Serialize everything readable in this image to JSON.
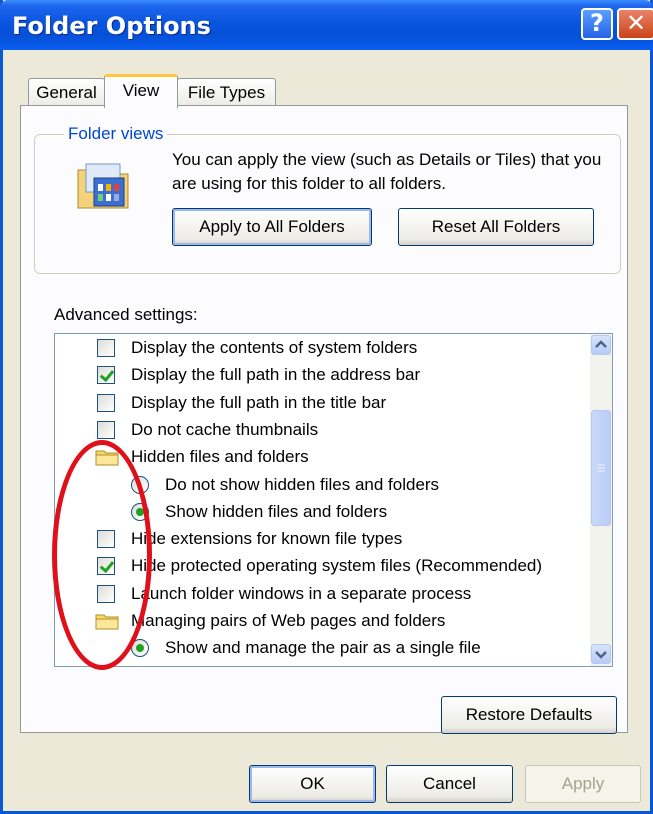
{
  "window": {
    "title": "Folder Options",
    "help_glyph": "?",
    "close_glyph": "✕"
  },
  "tabs": [
    {
      "label": "General",
      "active": false
    },
    {
      "label": "View",
      "active": true
    },
    {
      "label": "File Types",
      "active": false
    }
  ],
  "folder_views": {
    "title": "Folder views",
    "description": "You can apply the view (such as Details or Tiles) that you are using for this folder to all folders.",
    "apply_button": "Apply to All Folders",
    "reset_button": "Reset All Folders",
    "icon": "folder-view-icon"
  },
  "advanced": {
    "label": "Advanced settings:",
    "items": [
      {
        "type": "checkbox",
        "label": "Display the contents of system folders",
        "checked": false,
        "indent": 0
      },
      {
        "type": "checkbox",
        "label": "Display the full path in the address bar",
        "checked": true,
        "indent": 0
      },
      {
        "type": "checkbox",
        "label": "Display the full path in the title bar",
        "checked": false,
        "indent": 0
      },
      {
        "type": "checkbox",
        "label": "Do not cache thumbnails",
        "checked": false,
        "indent": 0
      },
      {
        "type": "folder",
        "label": "Hidden files and folders",
        "indent": 0
      },
      {
        "type": "radio",
        "label": "Do not show hidden files and folders",
        "checked": false,
        "indent": 1
      },
      {
        "type": "radio",
        "label": "Show hidden files and folders",
        "checked": true,
        "indent": 1
      },
      {
        "type": "checkbox",
        "label": "Hide extensions for known file types",
        "checked": false,
        "indent": 0
      },
      {
        "type": "checkbox",
        "label": "Hide protected operating system files (Recommended)",
        "checked": true,
        "indent": 0
      },
      {
        "type": "checkbox",
        "label": "Launch folder windows in a separate process",
        "checked": false,
        "indent": 0
      },
      {
        "type": "folder",
        "label": "Managing pairs of Web pages and folders",
        "indent": 0
      },
      {
        "type": "radio",
        "label": "Show and manage the pair as a single file",
        "checked": true,
        "indent": 1
      }
    ]
  },
  "buttons": {
    "restore": "Restore Defaults",
    "ok": "OK",
    "cancel": "Cancel",
    "apply": "Apply"
  },
  "colors": {
    "titlebar": "#0a55e0",
    "annotation": "#e0101a",
    "check": "#21a121"
  }
}
